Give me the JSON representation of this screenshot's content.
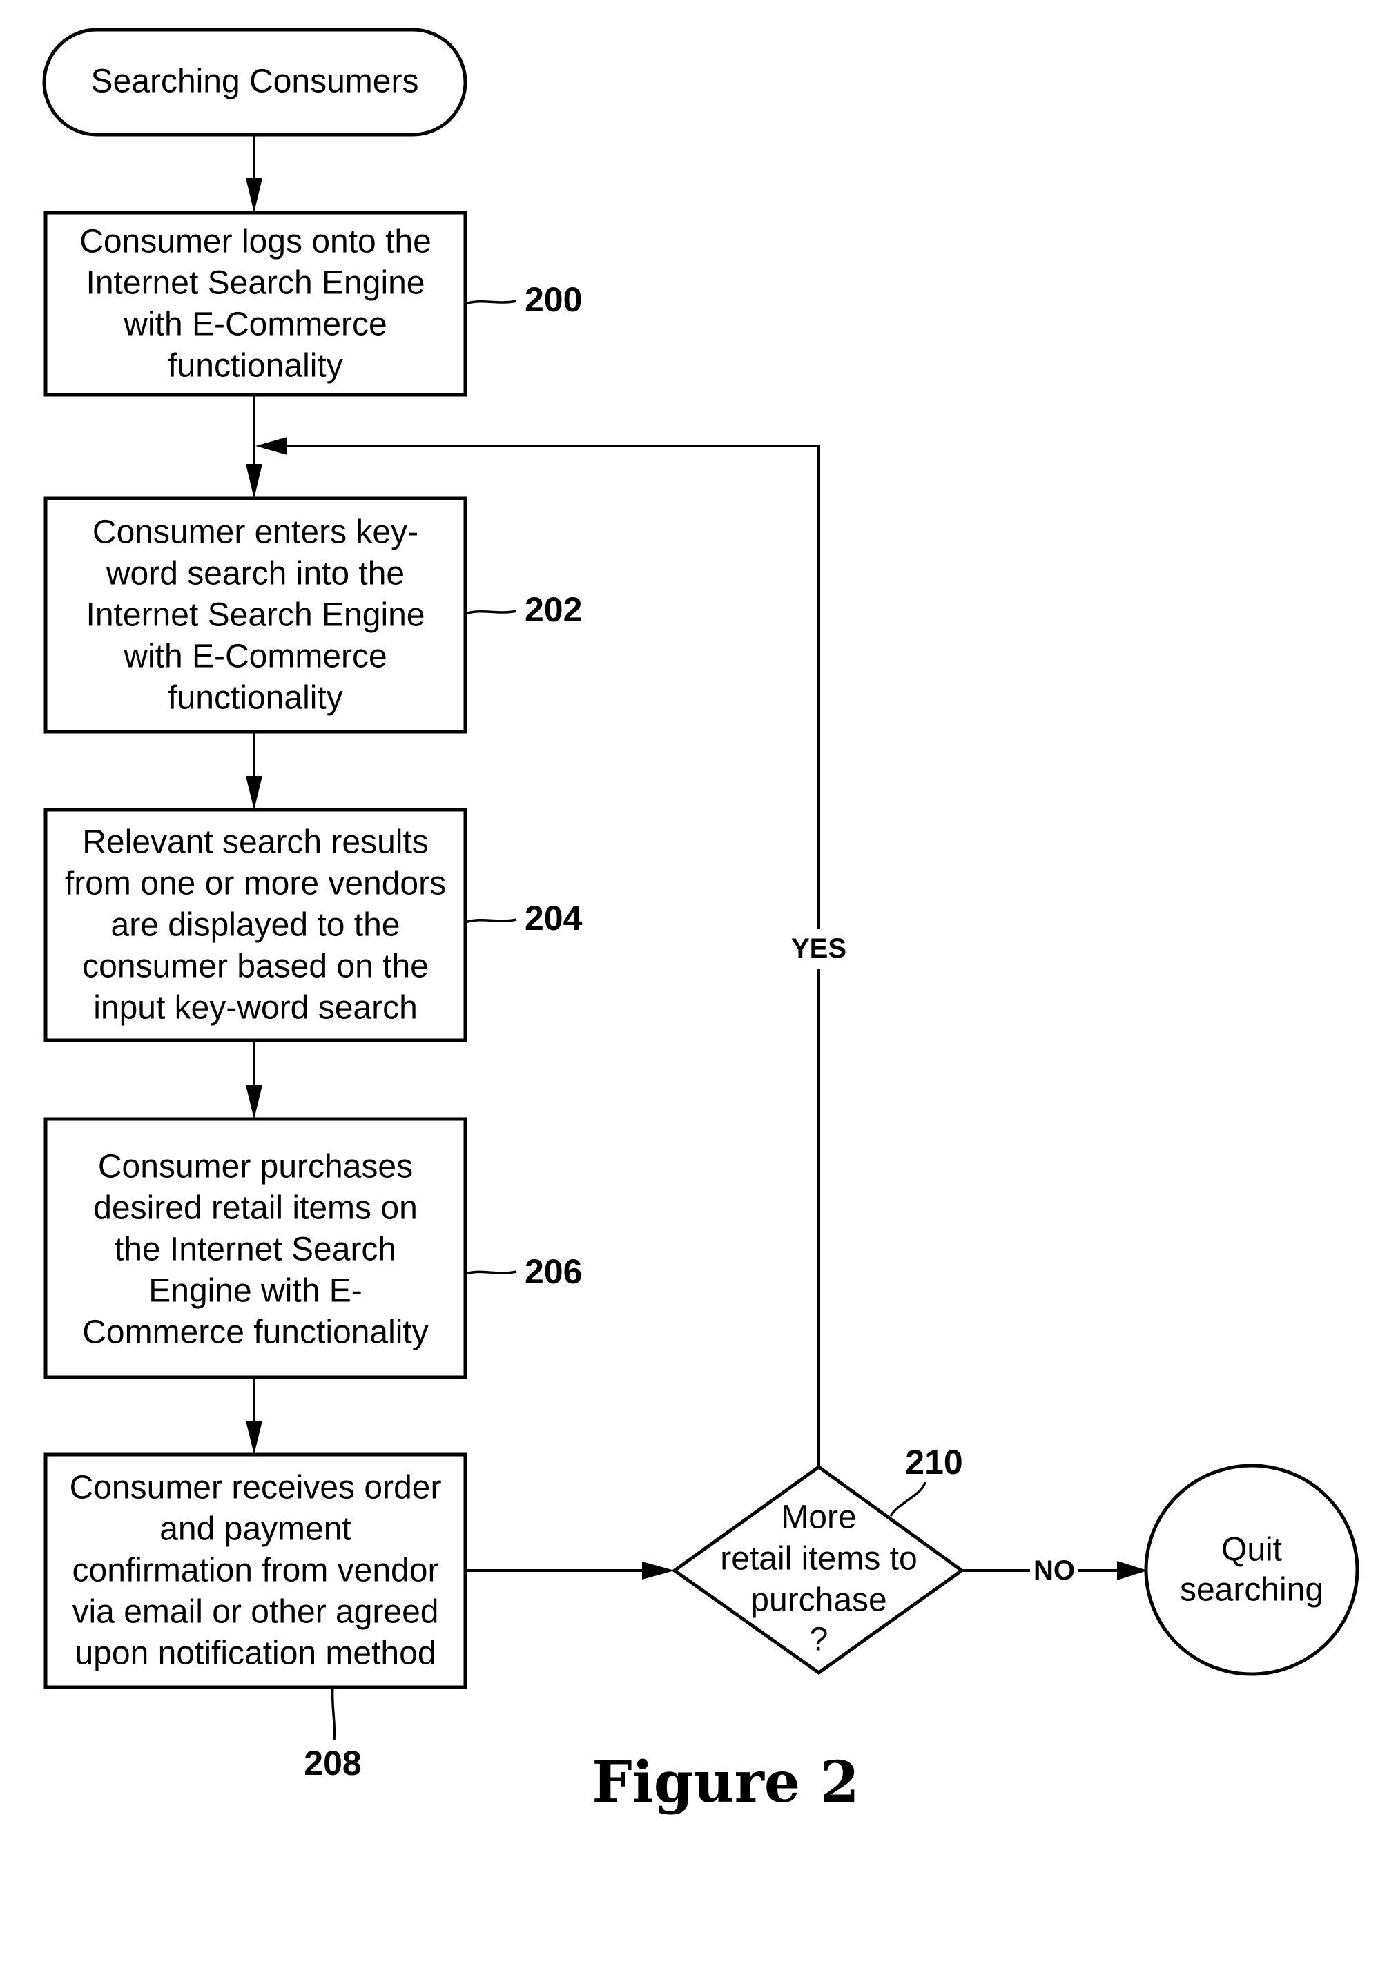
{
  "diagram": {
    "type": "flowchart",
    "caption": "Figure 2",
    "start": {
      "id": "start",
      "lines": [
        "Searching Consumers"
      ]
    },
    "steps": [
      {
        "id": "200",
        "ref": "200",
        "lines": [
          "Consumer logs onto the",
          "Internet Search Engine",
          "with E-Commerce",
          "functionality"
        ]
      },
      {
        "id": "202",
        "ref": "202",
        "lines": [
          "Consumer enters  key-",
          "word search into the",
          "Internet Search Engine",
          "with E-Commerce",
          "functionality"
        ]
      },
      {
        "id": "204",
        "ref": "204",
        "lines": [
          "Relevant search results",
          "from one or more vendors",
          "are displayed to the",
          "consumer based on the",
          "input key-word search"
        ]
      },
      {
        "id": "206",
        "ref": "206",
        "lines": [
          "Consumer purchases",
          "desired retail items on",
          "the Internet Search",
          "Engine with E-",
          "Commerce functionality"
        ]
      },
      {
        "id": "208",
        "ref": "208",
        "lines": [
          "Consumer receives order",
          "and payment",
          "confirmation from vendor",
          "via email or other agreed",
          "upon notification method"
        ]
      }
    ],
    "decision": {
      "id": "210",
      "ref": "210",
      "lines": [
        "More",
        "retail items to",
        "purchase",
        "?"
      ]
    },
    "end": {
      "id": "end",
      "lines": [
        "Quit",
        "searching"
      ]
    },
    "edges": [
      {
        "from": "start",
        "to": "200",
        "label": ""
      },
      {
        "from": "200",
        "to": "202",
        "label": ""
      },
      {
        "from": "202",
        "to": "204",
        "label": ""
      },
      {
        "from": "204",
        "to": "206",
        "label": ""
      },
      {
        "from": "206",
        "to": "208",
        "label": ""
      },
      {
        "from": "208",
        "to": "210",
        "label": ""
      },
      {
        "from": "210",
        "to": "202",
        "label": "YES"
      },
      {
        "from": "210",
        "to": "end",
        "label": "NO"
      }
    ]
  }
}
